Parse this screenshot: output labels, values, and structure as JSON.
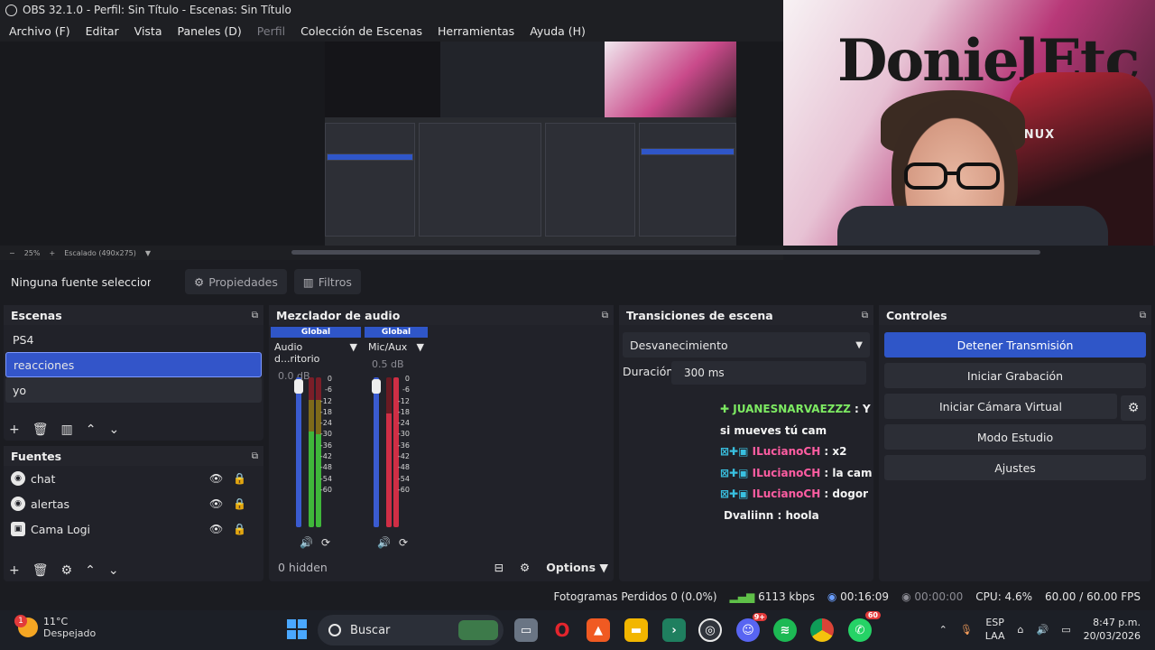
{
  "window": {
    "title": "OBS 32.1.0 - Perfil: Sin Título - Escenas: Sin Título"
  },
  "menu": [
    "Archivo (F)",
    "Editar",
    "Vista",
    "Paneles (D)",
    "Perfil",
    "Colección de Escenas",
    "Herramientas",
    "Ayuda (H)"
  ],
  "preview": {
    "zoom": "25%",
    "scale": "Escalado (490x275)",
    "cam_text": "DonielEtc",
    "chair_text": "AGNUX"
  },
  "source_bar": {
    "no_source": "Ninguna fuente seleccionada",
    "properties": "Propiedades",
    "filters": "Filtros"
  },
  "scenes": {
    "title": "Escenas",
    "items": [
      "PS4",
      "reacciones",
      "yo"
    ],
    "selected": "reacciones"
  },
  "sources": {
    "title": "Fuentes",
    "items": [
      {
        "name": "chat",
        "icon": "browser-icon"
      },
      {
        "name": "alertas",
        "icon": "browser-icon"
      },
      {
        "name": "Cama Logi",
        "icon": "camera-icon"
      }
    ]
  },
  "mixer": {
    "title": "Mezclador de audio",
    "channels": [
      {
        "badge": "Global",
        "name": "Audio d...ritorio",
        "db": "0.0 dB"
      },
      {
        "badge": "Global",
        "name": "Mic/Aux",
        "db": "0.5 dB"
      }
    ],
    "scale": [
      "0",
      "-6",
      "-12",
      "-18",
      "-24",
      "-30",
      "-36",
      "-42",
      "-48",
      "-54",
      "-60"
    ],
    "hidden": "0 hidden",
    "options": "Options"
  },
  "transitions": {
    "title": "Transiciones de escena",
    "selected": "Desvanecimiento",
    "duration_label": "Duración",
    "duration_value": "300 ms"
  },
  "chat": [
    {
      "user": "JUANESNARVAEZZZ",
      "msg": "Y si mueves tú cam"
    },
    {
      "user": "ILucianoCH",
      "msg": "x2"
    },
    {
      "user": "ILucianoCH",
      "msg": "la cam"
    },
    {
      "user": "ILucianoCH",
      "msg": "dogor"
    },
    {
      "user": "Dvaliinn",
      "msg": "hoola"
    }
  ],
  "controls": {
    "title": "Controles",
    "stop_stream": "Detener Transmisión",
    "start_recording": "Iniciar Grabación",
    "virtual_cam": "Iniciar Cámara Virtual",
    "studio_mode": "Modo Estudio",
    "settings": "Ajustes"
  },
  "status": {
    "dropped": "Fotogramas Perdidos 0 (0.0%)",
    "bitrate": "6113 kbps",
    "stream_time": "00:16:09",
    "rec_time": "00:00:00",
    "cpu": "CPU: 4.6%",
    "fps": "60.00 / 60.00 FPS"
  },
  "taskbar": {
    "temp": "11°C",
    "weather": "Despejado",
    "weather_badge": "1",
    "search": "Buscar",
    "lang1": "ESP",
    "lang2": "LAA",
    "time": "8:47 p.m.",
    "date": "20/03/2026",
    "whatsapp_badge": "60",
    "discord_badge": "9+"
  },
  "colors": {
    "accent": "#2f56c8",
    "panel": "#212229",
    "bg": "#1b1c21",
    "chat_nick": "#7dea62",
    "chat_nick2": "#ff5da2"
  }
}
